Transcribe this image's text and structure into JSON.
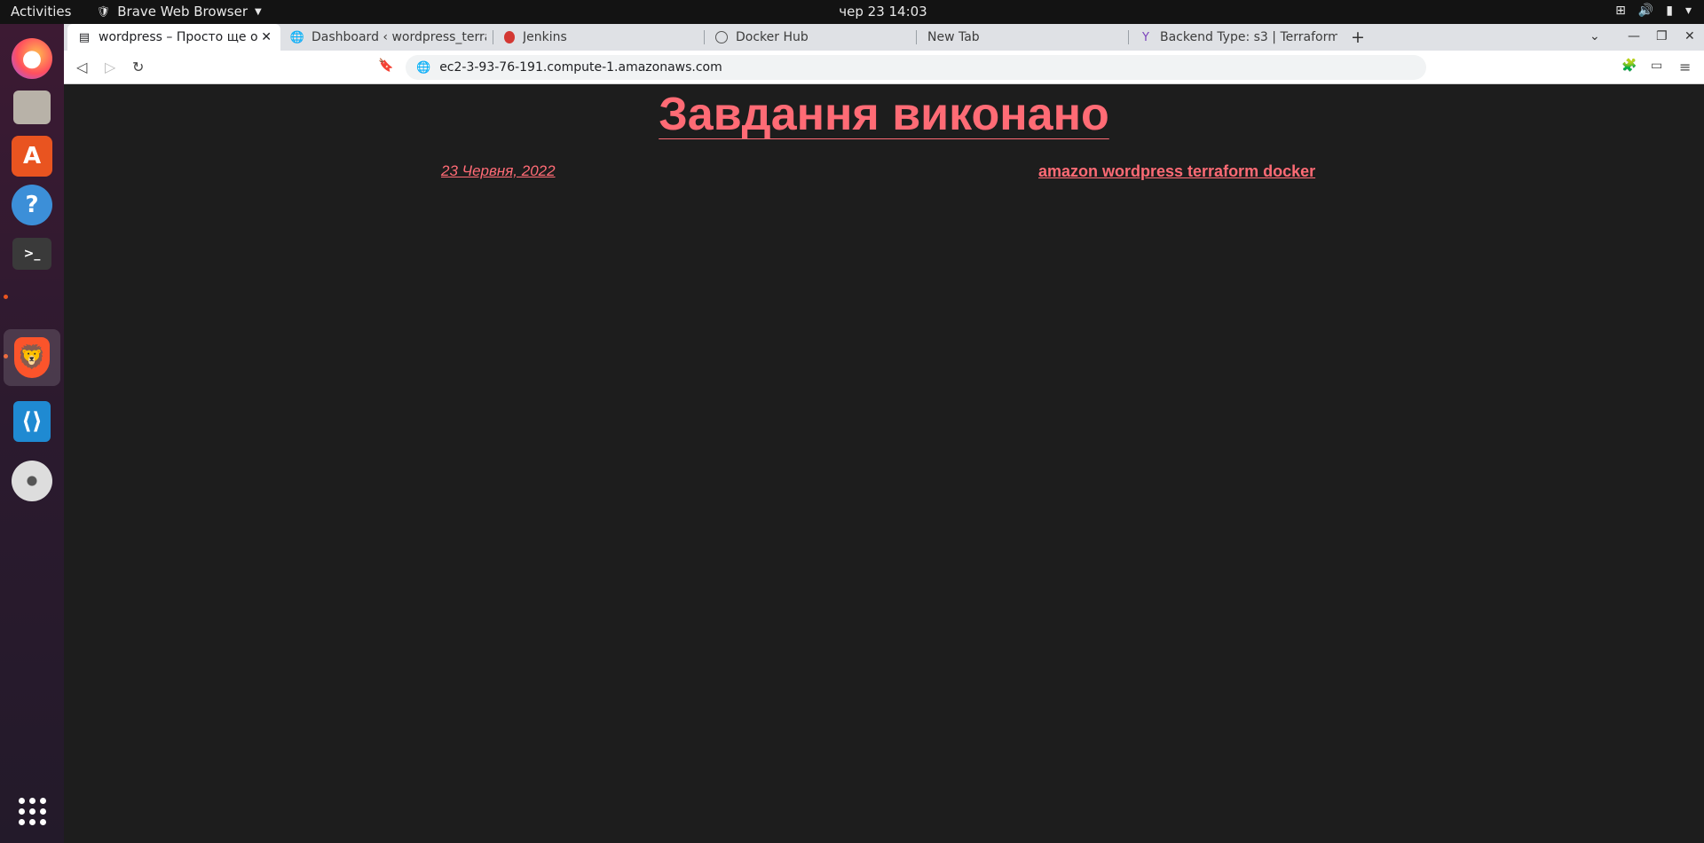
{
  "topbar": {
    "activities": "Activities",
    "app_name": "Brave Web Browser",
    "clock": "чер 23  14:03"
  },
  "dock": {
    "items": [
      "firefox-icon",
      "files-icon",
      "app-center-icon",
      "help-icon",
      "terminal-icon",
      "brave-icon",
      "vscode-icon",
      "disc-icon",
      "show-apps-icon"
    ]
  },
  "tabs": [
    {
      "label": "wordpress – Просто ще о",
      "active": true
    },
    {
      "label": "Dashboard ‹ wordpress_terra"
    },
    {
      "label": "Jenkins"
    },
    {
      "label": "Docker Hub"
    },
    {
      "label": "New Tab"
    },
    {
      "label": "Backend Type: s3 | Terraform"
    }
  ],
  "toolbar": {
    "url": "ec2-3-93-76-191.compute-1.amazonaws.com"
  },
  "post": {
    "title": "Завдання виконано",
    "date": "23 Червня, 2022",
    "tags": "amazon wordpress terraform docker"
  },
  "colors": {
    "accent": "#ff6b75",
    "page_bg": "#1d1d1d"
  }
}
